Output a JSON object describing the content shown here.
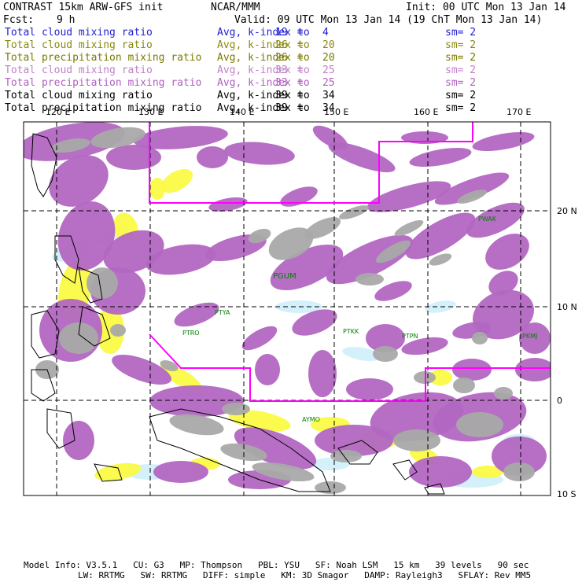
{
  "header": {
    "title": "CONTRAST 15km ARW-GFS init",
    "org": "NCAR/MMM",
    "init": "Init: 00 UTC Mon 13 Jan 14",
    "fcst_label": "Fcst:",
    "fcst_value": "9 h",
    "valid": "Valid: 09 UTC Mon 13 Jan 14 (19 ChT Mon 13 Jan 14)"
  },
  "legend": [
    {
      "name": "Total cloud mixing ratio",
      "avg": "Avg, k-index =",
      "k1": "19",
      "to": "to",
      "k2": "4",
      "sm": "sm= 2",
      "color": "#1f1fd0"
    },
    {
      "name": "Total cloud mixing ratio",
      "avg": "Avg, k-index =",
      "k1": "26",
      "to": "to",
      "k2": "20",
      "sm": "sm= 2",
      "color": "#8a8a10"
    },
    {
      "name": "Total precipitation mixing ratio",
      "avg": "Avg, k-index =",
      "k1": "26",
      "to": "to",
      "k2": "20",
      "sm": "sm= 2",
      "color": "#7a7a00"
    },
    {
      "name": "Total cloud mixing ratio",
      "avg": "Avg, k-index =",
      "k1": "33",
      "to": "to",
      "k2": "25",
      "sm": "sm= 2",
      "color": "#c080c8"
    },
    {
      "name": "Total precipitation mixing ratio",
      "avg": "Avg, k-index =",
      "k1": "33",
      "to": "to",
      "k2": "25",
      "sm": "sm= 2",
      "color": "#b060c0"
    },
    {
      "name": "Total cloud mixing ratio",
      "avg": "Avg, k-index =",
      "k1": "39",
      "to": "to",
      "k2": "34",
      "sm": "sm= 2",
      "color": "#000000"
    },
    {
      "name": "Total precipitation mixing ratio",
      "avg": "Avg, k-index =",
      "k1": "39",
      "to": "to",
      "k2": "34",
      "sm": "sm= 2",
      "color": "#000000"
    }
  ],
  "map": {
    "lon_labels": [
      "120 E",
      "130 E",
      "140 E",
      "150 E",
      "160 E",
      "170 E"
    ],
    "lat_labels": [
      "20 N",
      "10 N",
      "0",
      "10 S"
    ],
    "stations": [
      "PWAK",
      "PGUM",
      "PTYA",
      "PTRO",
      "PTKK",
      "PTPN",
      "PKMJ",
      "AYMO"
    ],
    "colors": {
      "purple": "#b267c2",
      "gray": "#a9a9a9",
      "yellow": "#fafa46",
      "lightblue": "#cfeefa",
      "domain_box": "#ff00ff",
      "station_text": "#008000",
      "grid": "#000000"
    }
  },
  "footer": {
    "line1": [
      {
        "label": "Model Info:",
        "value": "V3.5.1"
      },
      {
        "label": "CU:",
        "value": "G3"
      },
      {
        "label": "MP:",
        "value": "Thompson"
      },
      {
        "label": "PBL:",
        "value": "YSU"
      },
      {
        "label": "SF:",
        "value": "Noah LSM"
      },
      {
        "label": "",
        "value": "15 km"
      },
      {
        "label": "",
        "value": "39 levels"
      },
      {
        "label": "",
        "value": "90 sec"
      }
    ],
    "line2": [
      {
        "label": "LW:",
        "value": "RRTMG"
      },
      {
        "label": "SW:",
        "value": "RRTMG"
      },
      {
        "label": "DIFF:",
        "value": "simple"
      },
      {
        "label": "KM:",
        "value": "3D Smagor"
      },
      {
        "label": "DAMP:",
        "value": "Rayleigh3"
      },
      {
        "label": "SFLAY:",
        "value": "Rev MM5"
      }
    ]
  }
}
